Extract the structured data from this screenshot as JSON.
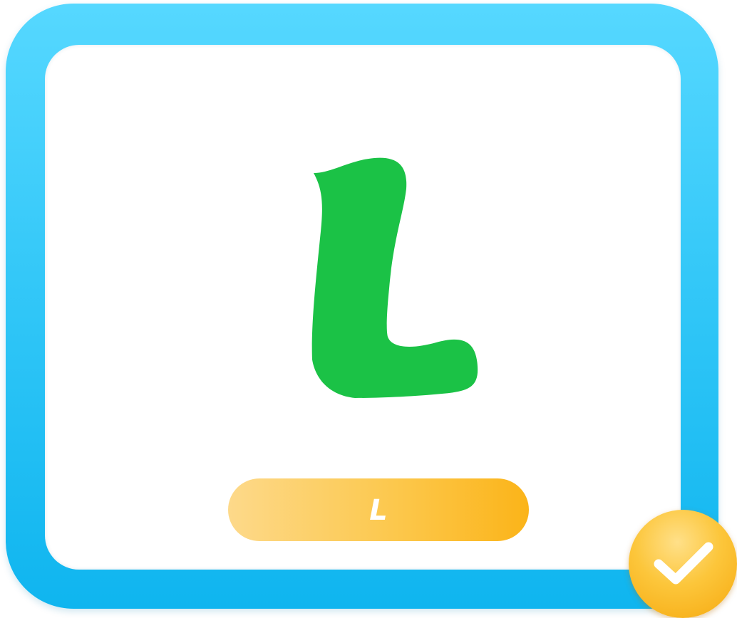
{
  "card": {
    "letter": "L",
    "letter_color": "#1bc246",
    "frame_color": "#2ec6f7"
  },
  "answer_button": {
    "label": "L"
  },
  "confirm": {
    "icon": "checkmark-icon",
    "state": "correct"
  }
}
